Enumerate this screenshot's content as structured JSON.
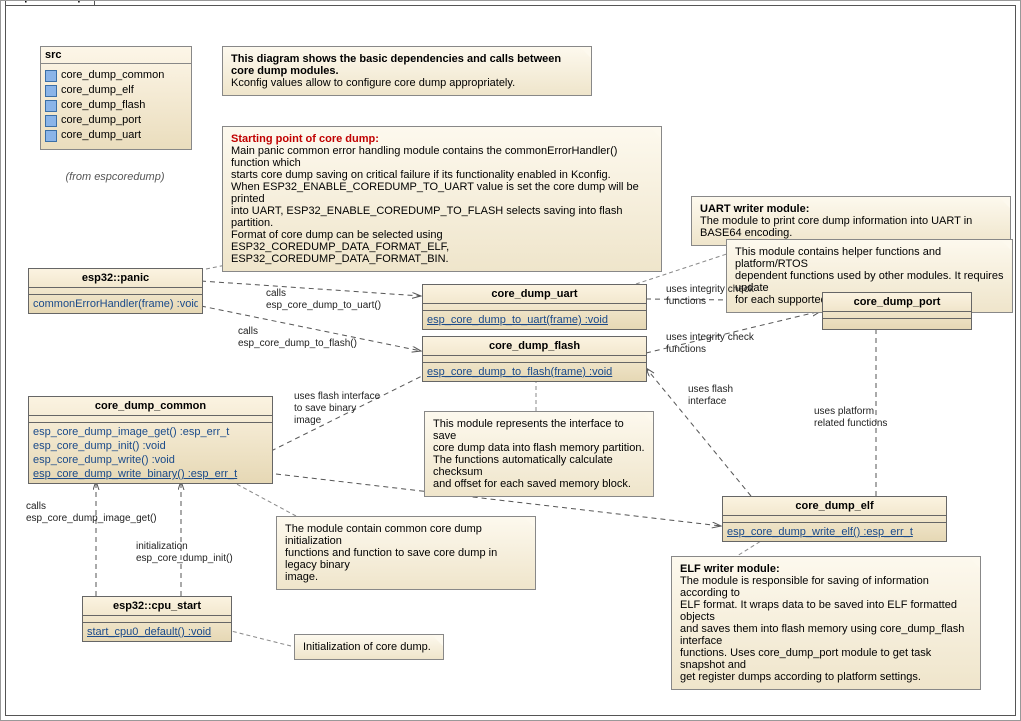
{
  "package": {
    "title": "espcoredump"
  },
  "src": {
    "title": "src",
    "items": [
      "core_dump_common",
      "core_dump_elf",
      "core_dump_flash",
      "core_dump_port",
      "core_dump_uart"
    ],
    "from": "(from espcoredump)"
  },
  "notes": {
    "intro": {
      "line1": "This diagram shows the basic dependencies and calls between core dump modules.",
      "line2": "Kconfig values allow to configure core dump appropriately."
    },
    "start": {
      "title": "Starting point of core dump:",
      "l1": "Main panic  common error handling module contains the commonErrorHandler() function which",
      "l2": "starts core dump saving on critical failure if its functionality enabled in Kconfig.",
      "l3": "When ESP32_ENABLE_COREDUMP_TO_UART value is set the core dump will be printed",
      "l4": "into UART, ESP32_ENABLE_COREDUMP_TO_FLASH selects saving into flash partition.",
      "l5": "Format of core dump can be selected using ESP32_COREDUMP_DATA_FORMAT_ELF,",
      "l6": "ESP32_COREDUMP_DATA_FORMAT_BIN."
    },
    "uart": {
      "title": "UART writer module:",
      "body": "The module to print core dump information into UART in BASE64 encoding."
    },
    "port": {
      "l1": "This module contains helper functions and platform/RTOS",
      "l2": "dependent functions used by other modules. It requires update",
      "l3": "for each supported platform."
    },
    "flash": {
      "l1": "This module represents the interface to save",
      "l2": "core dump data into flash memory partition.",
      "l3": "The functions automatically calculate checksum",
      "l4": "and offset for each saved memory block."
    },
    "common": {
      "l1": "The module contain common core dump initialization",
      "l2": "functions and function to save core dump in legacy binary",
      "l3": "image."
    },
    "init": {
      "body": "Initialization of core dump."
    },
    "elf": {
      "title": "ELF writer module:",
      "l1": "The module is responsible for saving of information according to",
      "l2": "ELF format. It wraps data to be saved into ELF formatted objects",
      "l3": "and saves them into flash memory using core_dump_flash interface",
      "l4": "functions. Uses core_dump_port module to get task snapshot and",
      "l5": "get register dumps according to platform settings."
    }
  },
  "classes": {
    "panic": {
      "name": "esp32::panic",
      "ops": [
        "commonErrorHandler(frame)  :void"
      ]
    },
    "uart": {
      "name": "core_dump_uart",
      "ops": [
        "esp_core_dump_to_uart(frame)  :void"
      ]
    },
    "flash": {
      "name": "core_dump_flash",
      "ops": [
        "esp_core_dump_to_flash(frame)  :void"
      ]
    },
    "port": {
      "name": "core_dump_port",
      "ops": []
    },
    "common": {
      "name": "core_dump_common",
      "ops": [
        "esp_core_dump_image_get()  :esp_err_t",
        "esp_core_dump_init()  :void",
        "esp_core_dump_write()  :void",
        "esp_core_dump_write_binary()  :esp_err_t"
      ]
    },
    "elf": {
      "name": "core_dump_elf",
      "ops": [
        "esp_core_dump_write_elf()  :esp_err_t"
      ]
    },
    "cpu": {
      "name": "esp32::cpu_start",
      "ops": [
        "start_cpu0_default()  :void"
      ]
    }
  },
  "labels": {
    "calls_uart": "calls\nesp_core_dump_to_uart()",
    "calls_flash": "calls\nesp_core_dump_to_flash()",
    "uses_integrity": "uses integrity check\nfunctions",
    "uses_flash_if": "uses flash\ninterface",
    "uses_flash_bin": "uses flash interface\nto save binary\nimage",
    "uses_platform": "uses platform\nrelated functions",
    "calls_img": "calls\nesp_core_dump_image_get()",
    "init": "initialization\nesp_core_dump_init()"
  }
}
